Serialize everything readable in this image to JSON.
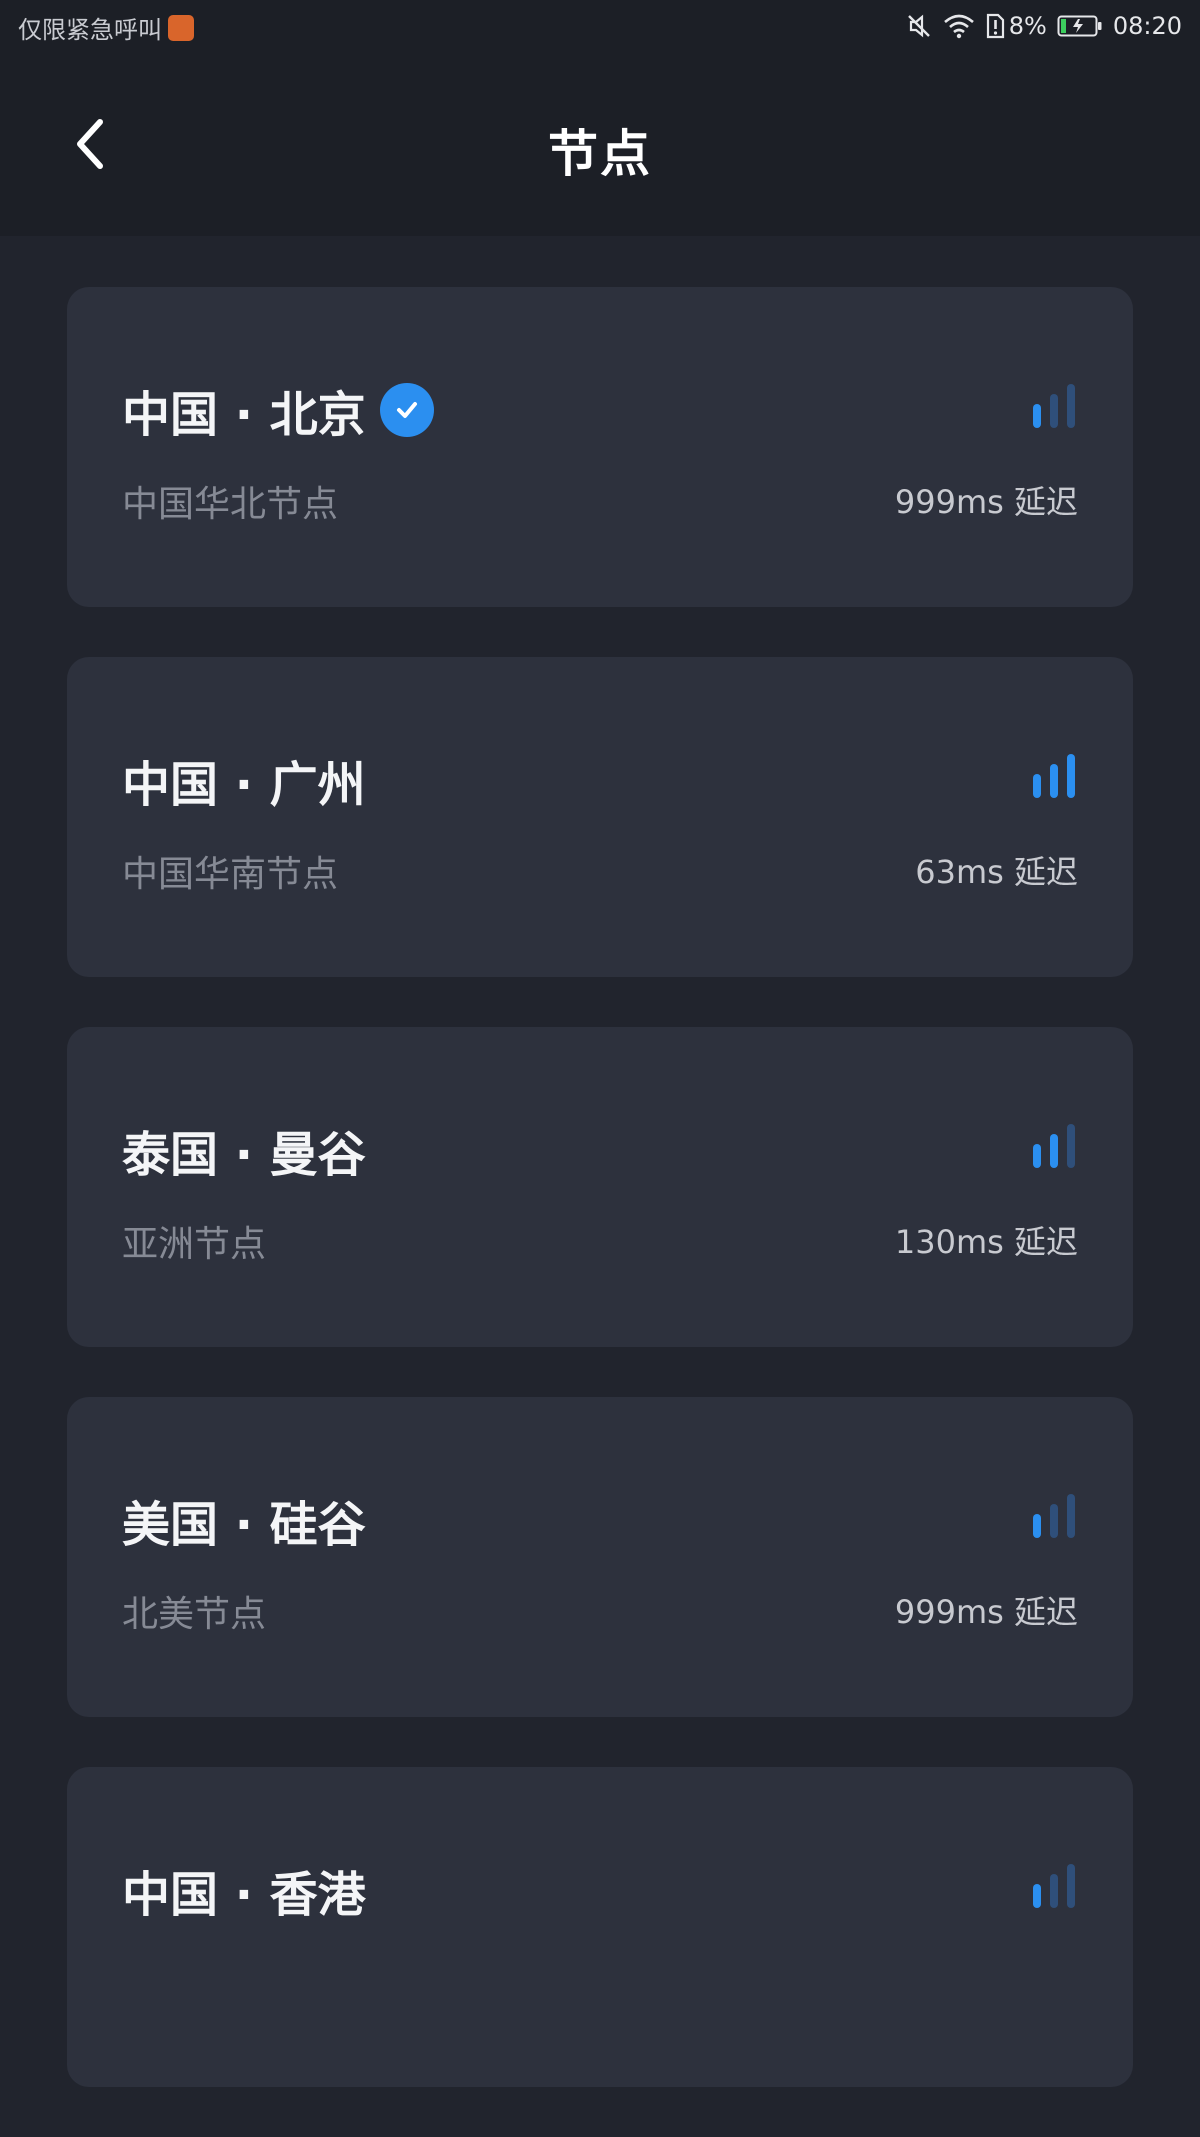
{
  "status_bar": {
    "carrier_text": "仅限紧急呼叫",
    "battery_percent": "8%",
    "time": "08:20",
    "icons": [
      "mute-icon",
      "wifi-icon",
      "sim-alert-icon",
      "battery-charging-icon"
    ]
  },
  "header": {
    "title": "节点",
    "back_icon": "chevron-left-icon"
  },
  "colors": {
    "accent": "#2b8ff0",
    "signal_dim": "#2f4f7a",
    "card_bg": "#2d313d",
    "page_bg": "#21242d"
  },
  "nodes": [
    {
      "title": "中国 · 北京",
      "subtitle": "中国华北节点",
      "latency": "999ms 延迟",
      "selected": true,
      "signal_bars": 1
    },
    {
      "title": "中国 · 广州",
      "subtitle": "中国华南节点",
      "latency": "63ms 延迟",
      "selected": false,
      "signal_bars": 3
    },
    {
      "title": "泰国 · 曼谷",
      "subtitle": "亚洲节点",
      "latency": "130ms 延迟",
      "selected": false,
      "signal_bars": 2
    },
    {
      "title": "美国 · 硅谷",
      "subtitle": "北美节点",
      "latency": "999ms 延迟",
      "selected": false,
      "signal_bars": 1
    },
    {
      "title": "中国 · 香港",
      "subtitle": "",
      "latency": "",
      "selected": false,
      "signal_bars": 1
    }
  ]
}
